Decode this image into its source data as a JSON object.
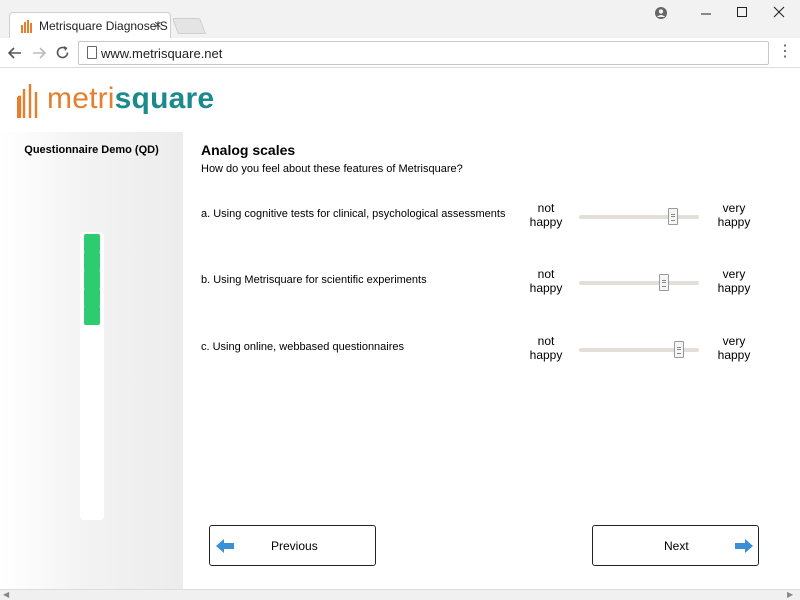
{
  "browser": {
    "tab_title": "Metrisquare DiagnoseIS",
    "tab_close": "×",
    "url": "www.metrisquare.net",
    "menu": "⋮"
  },
  "logo": {
    "part1": "metri",
    "part2": "square"
  },
  "sidebar": {
    "title": "Questionnaire Demo (QD)",
    "progress_segments": 5,
    "progress_fraction": 0.32
  },
  "main": {
    "title": "Analog scales",
    "subtitle": "How do you feel about these features of Metrisquare?",
    "questions": [
      {
        "label": "a. Using cognitive tests for clinical, psychological assessments",
        "left": [
          "not",
          "happy"
        ],
        "right": [
          "very",
          "happy"
        ],
        "value": 0.78
      },
      {
        "label": "b. Using Metrisquare for scientific experiments",
        "left": [
          "not",
          "happy"
        ],
        "right": [
          "very",
          "happy"
        ],
        "value": 0.71
      },
      {
        "label": "c. Using online, webbased questionnaires",
        "left": [
          "not",
          "happy"
        ],
        "right": [
          "very",
          "happy"
        ],
        "value": 0.83
      }
    ]
  },
  "buttons": {
    "previous": "Previous",
    "next": "Next"
  },
  "colors": {
    "accent_orange": "#e67e2e",
    "accent_teal": "#1a8a8c",
    "progress_green": "#2ecc71",
    "arrow_blue": "#3a8fd6"
  }
}
